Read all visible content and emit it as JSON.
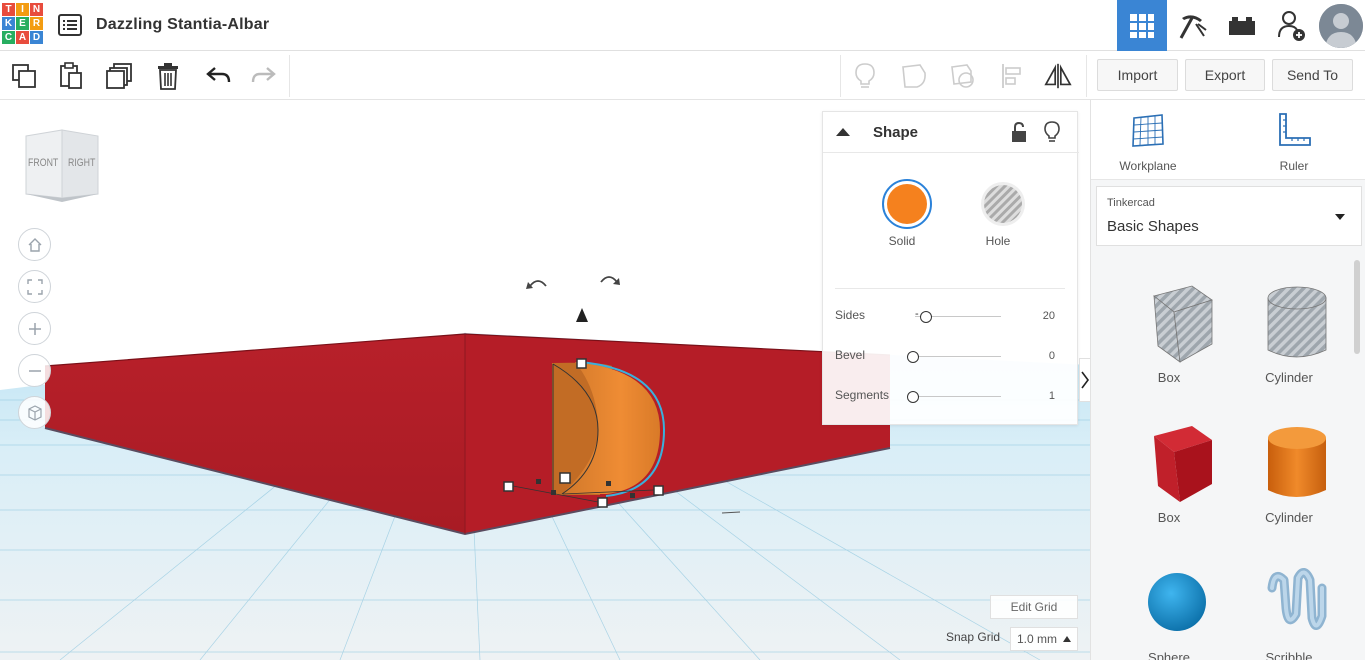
{
  "app": {
    "logo_letters": [
      "T",
      "I",
      "N",
      "K",
      "E",
      "R",
      "C",
      "A",
      "D"
    ],
    "logo_colors": [
      "#e84c3d",
      "#f39c12",
      "#e84c3d",
      "#3a85d4",
      "#27ae60",
      "#f39c12",
      "#27ae60",
      "#e84c3d",
      "#3a85d4"
    ],
    "document_title": "Dazzling Stantia-Albar"
  },
  "header": {
    "icons": [
      "3d-design-icon",
      "pickaxe-icon",
      "bricks-icon",
      "add-user-icon",
      "user-avatar"
    ],
    "active_color": "#3a85d4"
  },
  "toolbar": {
    "left_icons": [
      "copy-icon",
      "paste-icon",
      "duplicate-icon",
      "delete-icon",
      "undo-icon",
      "redo-icon"
    ],
    "right_icons": [
      "light-bulb-icon",
      "shape-outline-icon",
      "shape-group-icon",
      "align-icon",
      "mirror-icon"
    ],
    "import_label": "Import",
    "export_label": "Export",
    "send_to_label": "Send To"
  },
  "viewcube": {
    "front": "FRONT",
    "right": "RIGHT"
  },
  "inspector": {
    "title": "Shape",
    "solid_label": "Solid",
    "hole_label": "Hole",
    "solid_color": "#f5811e",
    "props": [
      {
        "label": "Sides",
        "value": "20"
      },
      {
        "label": "Bevel",
        "value": "0"
      },
      {
        "label": "Segments",
        "value": "1"
      }
    ]
  },
  "grid": {
    "edit_grid_label": "Edit Grid",
    "snap_grid_label": "Snap Grid",
    "snap_value": "1.0 mm"
  },
  "right_panel": {
    "workplane_label": "Workplane",
    "ruler_label": "Ruler",
    "library_category": "Tinkercad",
    "library_name": "Basic Shapes",
    "shapes": [
      {
        "label": "Box",
        "kind": "box-hole"
      },
      {
        "label": "Cylinder",
        "kind": "cylinder-hole"
      },
      {
        "label": "Box",
        "kind": "box"
      },
      {
        "label": "Cylinder",
        "kind": "cylinder"
      },
      {
        "label": "Sphere",
        "kind": "sphere"
      },
      {
        "label": "Scribble",
        "kind": "scribble"
      }
    ]
  }
}
